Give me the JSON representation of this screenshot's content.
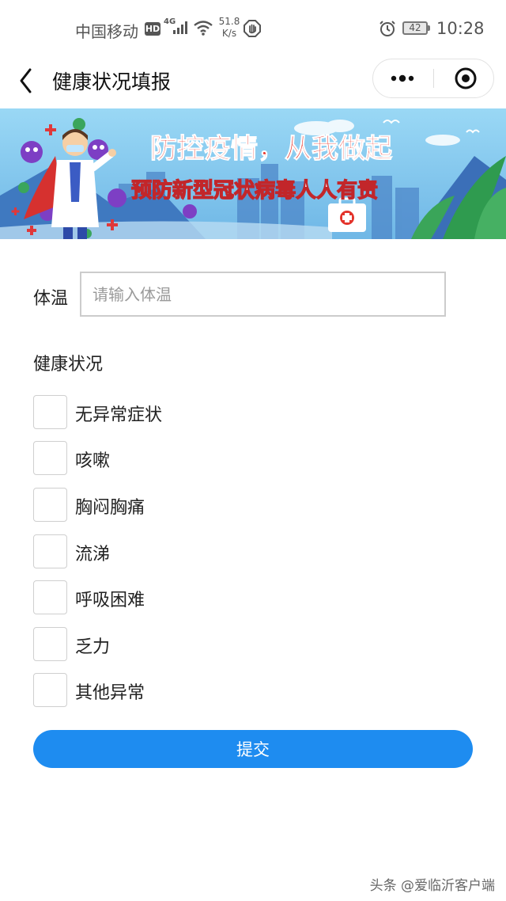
{
  "status_bar": {
    "carrier": "中国移动",
    "hd_badge": "HD",
    "network_type": "4G",
    "speed_value": "51.8",
    "speed_unit": "K/s",
    "battery": "42",
    "time": "10:28"
  },
  "nav": {
    "title": "健康状况填报",
    "icons": [
      "back-icon",
      "more-icon",
      "close-target-icon"
    ]
  },
  "banner": {
    "headline": "防控疫情，从我做起",
    "subheadline": "预防新型冠状病毒人人有责",
    "colors": {
      "sky": "#8fd0f2",
      "headline": "#e8332a",
      "subheadline": "#ffffff",
      "accent_green": "#2f9b4f"
    }
  },
  "form": {
    "temperature_label": "体温",
    "temperature_placeholder": "请输入体温",
    "temperature_value": "",
    "health_title": "健康状况",
    "options": [
      {
        "label": "无异常症状",
        "checked": false
      },
      {
        "label": "咳嗽",
        "checked": false
      },
      {
        "label": "胸闷胸痛",
        "checked": false
      },
      {
        "label": "流涕",
        "checked": false
      },
      {
        "label": "呼吸困难",
        "checked": false
      },
      {
        "label": "乏力",
        "checked": false
      },
      {
        "label": "其他异常",
        "checked": false
      }
    ],
    "submit_label": "提交",
    "submit_color": "#1e8cf0"
  },
  "watermark": "头条 @爱临沂客户端"
}
